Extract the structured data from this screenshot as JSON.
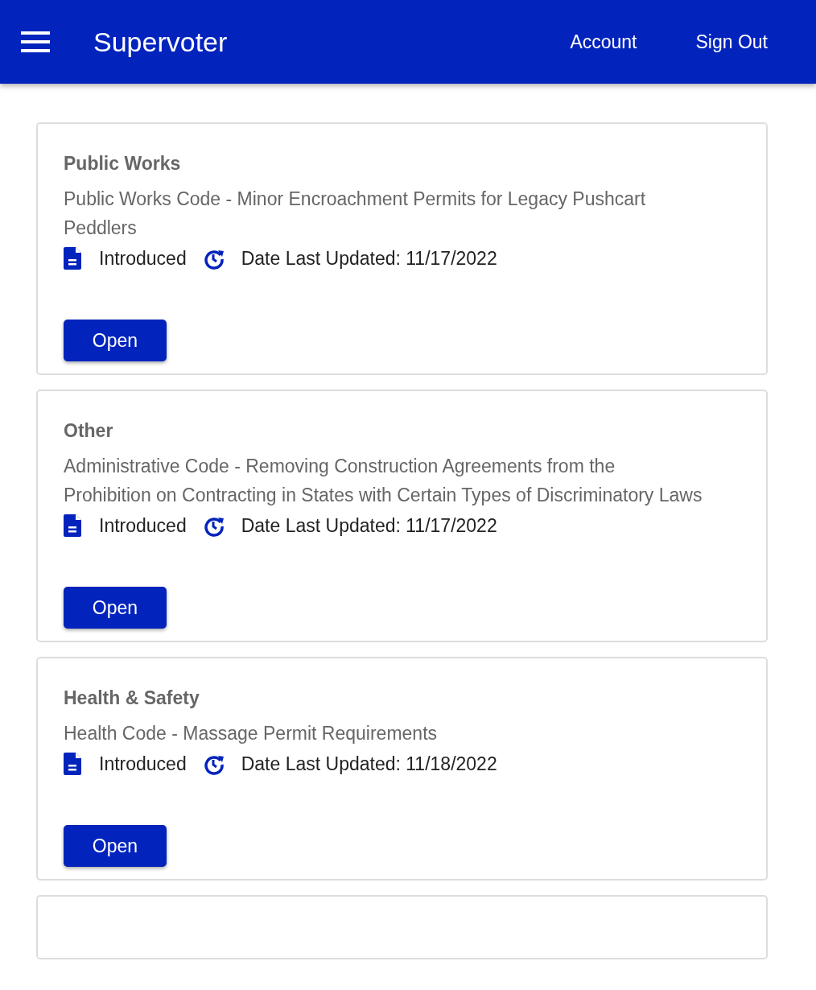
{
  "header": {
    "title": "Supervoter",
    "links": [
      "Account",
      "Sign Out"
    ]
  },
  "cards": [
    {
      "kind": "full",
      "category": "Public Works",
      "description": "Public Works Code - Minor Encroachment Permits for Legacy Pushcart Peddlers",
      "status": "Introduced",
      "updated": "Date Last Updated: 11/17/2022",
      "button": "Open"
    },
    {
      "kind": "full",
      "category": "Other",
      "description": "Administrative Code - Removing Construction Agreements from the Prohibition on Contracting in States with Certain Types of Discriminatory Laws",
      "status": "Introduced",
      "updated": "Date Last Updated: 11/17/2022",
      "button": "Open"
    },
    {
      "kind": "full",
      "category": "Health & Safety",
      "description": "Health Code - Massage Permit Requirements",
      "status": "Introduced",
      "updated": "Date Last Updated: 11/18/2022",
      "button": "Open"
    },
    {
      "kind": "partial"
    }
  ]
}
